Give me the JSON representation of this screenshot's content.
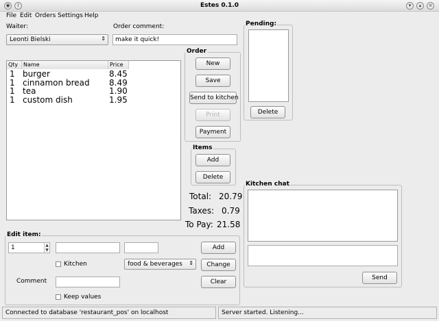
{
  "window": {
    "title": "Estes 0.1.0"
  },
  "menu": [
    "File",
    "Edit",
    "Orders",
    "Settings",
    "Help"
  ],
  "waiter": {
    "label": "Waiter:",
    "value": "Leonti Bielski"
  },
  "order_comment": {
    "label": "Order comment:",
    "value": "make it quick!"
  },
  "items_table": {
    "columns": [
      "Qty",
      "Name",
      "Price"
    ],
    "rows": [
      {
        "qty": "1",
        "name": "burger",
        "price": "8.45"
      },
      {
        "qty": "1",
        "name": "cinnamon bread",
        "price": "8.49"
      },
      {
        "qty": "1",
        "name": "tea",
        "price": "1.90"
      },
      {
        "qty": "1",
        "name": "custom dish",
        "price": "1.95"
      }
    ]
  },
  "order_group": {
    "title": "Order",
    "buttons": {
      "new": "New",
      "save": "Save",
      "send": "Send to kitchen",
      "print": "Print",
      "payment": "Payment"
    }
  },
  "items_group": {
    "title": "Items",
    "add": "Add",
    "delete": "Delete"
  },
  "totals": {
    "total_label": "Total:",
    "total": "20.79",
    "taxes_label": "Taxes:",
    "taxes": "0.79",
    "topay_label": "To Pay:",
    "topay": "21.58"
  },
  "pending": {
    "title": "Pending:",
    "delete": "Delete"
  },
  "kitchen_chat": {
    "title": "Kitchen chat",
    "send": "Send"
  },
  "edit_item": {
    "title": "Edit item:",
    "qty": "1",
    "kitchen_label": "Kitchen",
    "category": "food & beverages",
    "comment_label": "Comment",
    "keep_label": "Keep values",
    "add": "Add",
    "change": "Change",
    "clear": "Clear"
  },
  "status": {
    "left": "Connected to database 'restaurant_pos' on localhost",
    "right": "Server started. Listening..."
  }
}
